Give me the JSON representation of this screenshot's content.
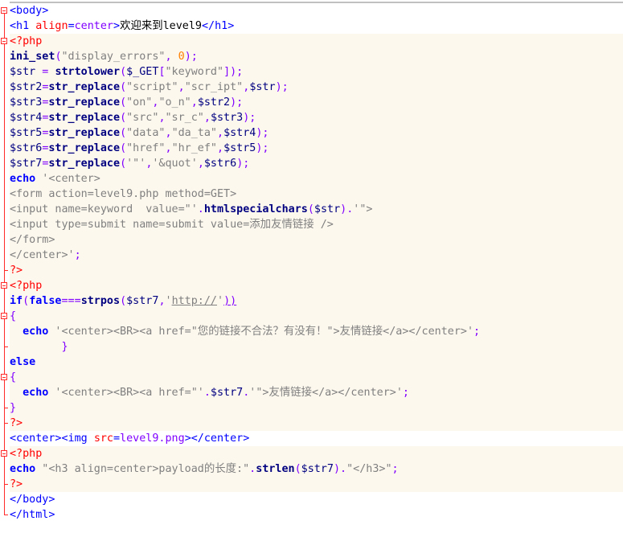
{
  "lines": [
    [
      {
        "t": "<body>",
        "c": "tag"
      }
    ],
    [
      {
        "t": "<h1 ",
        "c": "tag"
      },
      {
        "t": "align",
        "c": "attr"
      },
      {
        "t": "=",
        "c": "tag"
      },
      {
        "t": "center",
        "c": "val"
      },
      {
        "t": ">",
        "c": "tag"
      },
      {
        "t": "欢迎来到level9",
        "c": "plain"
      },
      {
        "t": "</h1>",
        "c": "tag"
      }
    ],
    [
      {
        "t": "<?php",
        "c": "phpdelim"
      }
    ],
    [
      {
        "t": "ini_set",
        "c": "fn"
      },
      {
        "t": "(",
        "c": "op"
      },
      {
        "t": "\"display_errors\"",
        "c": "str"
      },
      {
        "t": ", ",
        "c": "op"
      },
      {
        "t": "0",
        "c": "num"
      },
      {
        "t": ");",
        "c": "op"
      }
    ],
    [
      {
        "t": "$str",
        "c": "var"
      },
      {
        "t": " = ",
        "c": "op"
      },
      {
        "t": "strtolower",
        "c": "fn"
      },
      {
        "t": "(",
        "c": "op"
      },
      {
        "t": "$_GET",
        "c": "var"
      },
      {
        "t": "[",
        "c": "op"
      },
      {
        "t": "\"keyword\"",
        "c": "str"
      },
      {
        "t": "]);",
        "c": "op"
      }
    ],
    [
      {
        "t": "$str2",
        "c": "var"
      },
      {
        "t": "=",
        "c": "op"
      },
      {
        "t": "str_replace",
        "c": "fn"
      },
      {
        "t": "(",
        "c": "op"
      },
      {
        "t": "\"script\"",
        "c": "str"
      },
      {
        "t": ",",
        "c": "op"
      },
      {
        "t": "\"scr_ipt\"",
        "c": "str"
      },
      {
        "t": ",",
        "c": "op"
      },
      {
        "t": "$str",
        "c": "var"
      },
      {
        "t": ");",
        "c": "op"
      }
    ],
    [
      {
        "t": "$str3",
        "c": "var"
      },
      {
        "t": "=",
        "c": "op"
      },
      {
        "t": "str_replace",
        "c": "fn"
      },
      {
        "t": "(",
        "c": "op"
      },
      {
        "t": "\"on\"",
        "c": "str"
      },
      {
        "t": ",",
        "c": "op"
      },
      {
        "t": "\"o_n\"",
        "c": "str"
      },
      {
        "t": ",",
        "c": "op"
      },
      {
        "t": "$str2",
        "c": "var"
      },
      {
        "t": ");",
        "c": "op"
      }
    ],
    [
      {
        "t": "$str4",
        "c": "var"
      },
      {
        "t": "=",
        "c": "op"
      },
      {
        "t": "str_replace",
        "c": "fn"
      },
      {
        "t": "(",
        "c": "op"
      },
      {
        "t": "\"src\"",
        "c": "str"
      },
      {
        "t": ",",
        "c": "op"
      },
      {
        "t": "\"sr_c\"",
        "c": "str"
      },
      {
        "t": ",",
        "c": "op"
      },
      {
        "t": "$str3",
        "c": "var"
      },
      {
        "t": ");",
        "c": "op"
      }
    ],
    [
      {
        "t": "$str5",
        "c": "var"
      },
      {
        "t": "=",
        "c": "op"
      },
      {
        "t": "str_replace",
        "c": "fn"
      },
      {
        "t": "(",
        "c": "op"
      },
      {
        "t": "\"data\"",
        "c": "str"
      },
      {
        "t": ",",
        "c": "op"
      },
      {
        "t": "\"da_ta\"",
        "c": "str"
      },
      {
        "t": ",",
        "c": "op"
      },
      {
        "t": "$str4",
        "c": "var"
      },
      {
        "t": ");",
        "c": "op"
      }
    ],
    [
      {
        "t": "$str6",
        "c": "var"
      },
      {
        "t": "=",
        "c": "op"
      },
      {
        "t": "str_replace",
        "c": "fn"
      },
      {
        "t": "(",
        "c": "op"
      },
      {
        "t": "\"href\"",
        "c": "str"
      },
      {
        "t": ",",
        "c": "op"
      },
      {
        "t": "\"hr_ef\"",
        "c": "str"
      },
      {
        "t": ",",
        "c": "op"
      },
      {
        "t": "$str5",
        "c": "var"
      },
      {
        "t": ");",
        "c": "op"
      }
    ],
    [
      {
        "t": "$str7",
        "c": "var"
      },
      {
        "t": "=",
        "c": "op"
      },
      {
        "t": "str_replace",
        "c": "fn"
      },
      {
        "t": "(",
        "c": "op"
      },
      {
        "t": "'\"'",
        "c": "str"
      },
      {
        "t": ",",
        "c": "op"
      },
      {
        "t": "'&quot'",
        "c": "str"
      },
      {
        "t": ",",
        "c": "op"
      },
      {
        "t": "$str6",
        "c": "var"
      },
      {
        "t": ");",
        "c": "op"
      }
    ],
    [
      {
        "t": "echo",
        "c": "kw"
      },
      {
        "t": " '<center>",
        "c": "str"
      }
    ],
    [
      {
        "t": "<form action=level9.php method=GET>",
        "c": "str"
      }
    ],
    [
      {
        "t": "<input name=keyword  value=\"'",
        "c": "str"
      },
      {
        "t": ".",
        "c": "op"
      },
      {
        "t": "htmlspecialchars",
        "c": "fn"
      },
      {
        "t": "(",
        "c": "op"
      },
      {
        "t": "$str",
        "c": "var"
      },
      {
        "t": ")",
        "c": "op"
      },
      {
        "t": ".",
        "c": "op"
      },
      {
        "t": "'\">",
        "c": "str"
      }
    ],
    [
      {
        "t": "<input type=submit name=submit value=添加友情链接 />",
        "c": "str"
      }
    ],
    [
      {
        "t": "</form>",
        "c": "str"
      }
    ],
    [
      {
        "t": "</center>'",
        "c": "str"
      },
      {
        "t": ";",
        "c": "op"
      }
    ],
    [
      {
        "t": "?>",
        "c": "phpdelim"
      }
    ],
    [
      {
        "t": "<?php",
        "c": "phpdelim"
      }
    ],
    [
      {
        "t": "if",
        "c": "kw"
      },
      {
        "t": "(",
        "c": "op"
      },
      {
        "t": "false",
        "c": "kw"
      },
      {
        "t": "===",
        "c": "op"
      },
      {
        "t": "strpos",
        "c": "fn"
      },
      {
        "t": "(",
        "c": "op"
      },
      {
        "t": "$str7",
        "c": "var"
      },
      {
        "t": ",",
        "c": "op"
      },
      {
        "t": "'",
        "c": "str"
      },
      {
        "t": "http://",
        "c": "str u"
      },
      {
        "t": "'",
        "c": "str"
      },
      {
        "t": "))",
        "c": "op u"
      }
    ],
    [
      {
        "t": "{",
        "c": "op"
      }
    ],
    [
      {
        "t": "  echo",
        "c": "kw"
      },
      {
        "t": " '<center><BR><a href=\"您的链接不合法？有没有！\">友情链接</a></center>'",
        "c": "str"
      },
      {
        "t": ";",
        "c": "op"
      }
    ],
    [
      {
        "t": "        }",
        "c": "op"
      }
    ],
    [
      {
        "t": "else",
        "c": "kw"
      }
    ],
    [
      {
        "t": "{",
        "c": "op"
      }
    ],
    [
      {
        "t": "  echo",
        "c": "kw"
      },
      {
        "t": " '<center><BR><a href=\"'",
        "c": "str"
      },
      {
        "t": ".",
        "c": "op"
      },
      {
        "t": "$str7",
        "c": "var"
      },
      {
        "t": ".",
        "c": "op"
      },
      {
        "t": "'\">友情链接</a></center>'",
        "c": "str"
      },
      {
        "t": ";",
        "c": "op"
      }
    ],
    [
      {
        "t": "}",
        "c": "op"
      }
    ],
    [
      {
        "t": "?>",
        "c": "phpdelim"
      }
    ],
    [
      {
        "t": "<center><img ",
        "c": "tag"
      },
      {
        "t": "src",
        "c": "attr"
      },
      {
        "t": "=",
        "c": "tag"
      },
      {
        "t": "level9.png",
        "c": "val"
      },
      {
        "t": "></center>",
        "c": "tag"
      }
    ],
    [
      {
        "t": "<?php",
        "c": "phpdelim"
      }
    ],
    [
      {
        "t": "echo",
        "c": "kw"
      },
      {
        "t": " \"<h3 align=center>payload的长度:\"",
        "c": "str"
      },
      {
        "t": ".",
        "c": "op"
      },
      {
        "t": "strlen",
        "c": "fn"
      },
      {
        "t": "(",
        "c": "op"
      },
      {
        "t": "$str7",
        "c": "var"
      },
      {
        "t": ")",
        "c": "op"
      },
      {
        "t": ".",
        "c": "op"
      },
      {
        "t": "\"</h3>\"",
        "c": "str"
      },
      {
        "t": ";",
        "c": "op"
      }
    ],
    [
      {
        "t": "?>",
        "c": "phpdelim"
      }
    ],
    [
      {
        "t": "</body>",
        "c": "tag"
      }
    ],
    [
      {
        "t": "</html>",
        "c": "tag"
      }
    ]
  ],
  "php_lines": [
    2,
    3,
    4,
    5,
    6,
    7,
    8,
    9,
    10,
    11,
    12,
    13,
    14,
    15,
    16,
    17,
    18,
    19,
    20,
    21,
    22,
    23,
    24,
    25,
    26,
    27,
    29,
    30,
    31
  ],
  "folds": [
    {
      "start": 0,
      "end": 33
    },
    {
      "start": 2,
      "end": 17
    },
    {
      "start": 18,
      "end": 27
    },
    {
      "start": 20,
      "end": 22
    },
    {
      "start": 24,
      "end": 26
    },
    {
      "start": 29,
      "end": 31
    }
  ]
}
